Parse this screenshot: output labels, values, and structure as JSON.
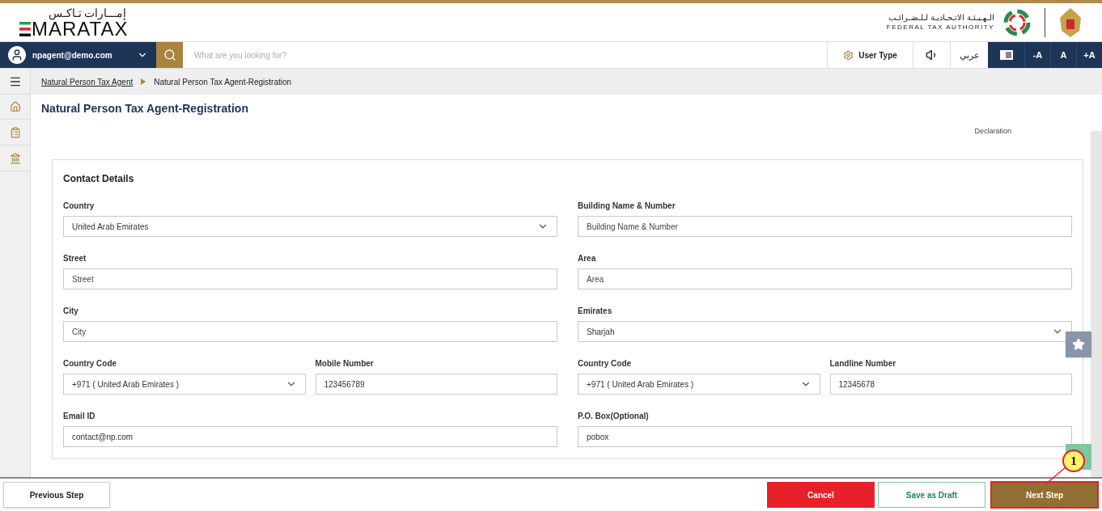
{
  "header": {
    "logo_arabic": "إمـــارات تـاكـس",
    "logo_text": "MARATAX",
    "authority_arabic": "الـهـيـئـة الاتـحـاديـة لـلـضـرائـب",
    "authority_name": "FEDERAL TAX AUTHORITY"
  },
  "navbar": {
    "user": "npagent@demo.com",
    "search": {
      "placeholder": "What are you looking for?"
    },
    "user_type": "User Type",
    "language": "عربي",
    "font_buttons": [
      "-A",
      "A",
      "+A"
    ]
  },
  "breadcrumb": [
    {
      "label": "Natural Person Tax Agent",
      "kind": "link"
    },
    {
      "label": "Natural Person Tax Agent-Registration",
      "kind": "current"
    }
  ],
  "page_title": "Natural Person Tax Agent-Registration",
  "stepper": {
    "last_step": "Declaration"
  },
  "form": {
    "title": "Contact Details",
    "rows": [
      {
        "left": [
          {
            "label": "Country",
            "kind": "select",
            "value": "United Arab Emirates"
          }
        ],
        "right": [
          {
            "label": "Building Name & Number",
            "kind": "input",
            "placeholder": "Building Name & Number"
          }
        ]
      },
      {
        "left": [
          {
            "label": "Street",
            "kind": "input",
            "placeholder": "Street"
          }
        ],
        "right": [
          {
            "label": "Area",
            "kind": "input",
            "placeholder": "Area"
          }
        ]
      },
      {
        "left": [
          {
            "label": "City",
            "kind": "input",
            "placeholder": "City"
          }
        ],
        "right": [
          {
            "label": "Emirates",
            "kind": "select",
            "value": "Sharjah"
          }
        ]
      },
      {
        "left": [
          {
            "label": "Country Code",
            "kind": "select",
            "value": "+971 ( United Arab Emirates )"
          },
          {
            "label": "Mobile Number",
            "kind": "input",
            "value": "123456789"
          }
        ],
        "right": [
          {
            "label": "Country Code",
            "kind": "select",
            "value": "+971 ( United Arab Emirates )"
          },
          {
            "label": "Landline Number",
            "kind": "input",
            "value": "12345678"
          }
        ]
      },
      {
        "left": [
          {
            "label": "Email ID",
            "kind": "input",
            "value": "contact@np.com"
          }
        ],
        "right": [
          {
            "label": "P.O. Box(Optional)",
            "kind": "input",
            "value": "pobox"
          }
        ]
      }
    ]
  },
  "footer": {
    "previous": "Previous Step",
    "cancel": "Cancel",
    "save_draft": "Save as Draft",
    "next": "Next Step"
  },
  "callout": {
    "number": "1"
  }
}
